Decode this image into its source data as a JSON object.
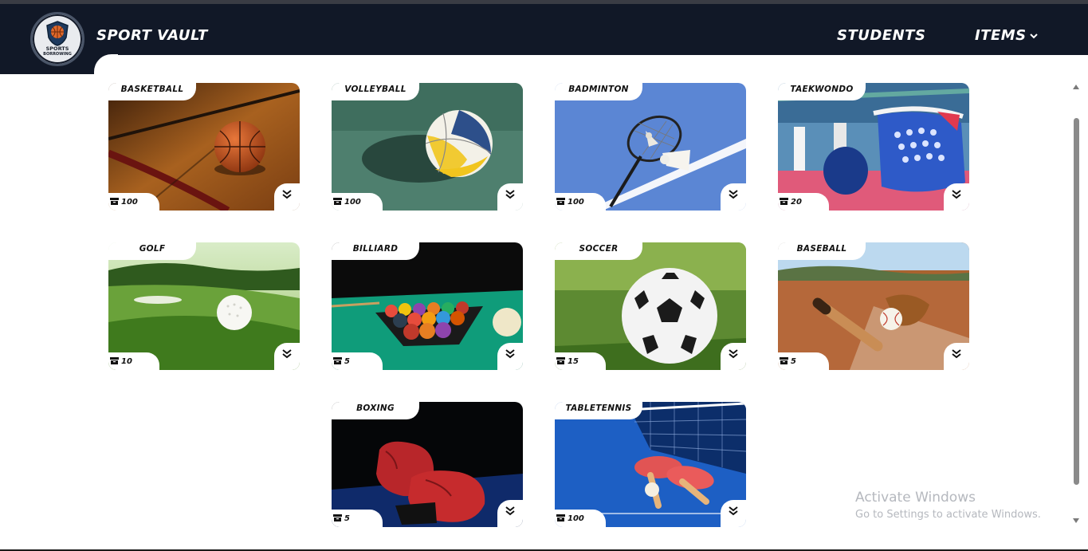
{
  "header": {
    "logo_text_line1": "SPORTS",
    "logo_text_line2": "BORROWING",
    "brand": "SPORT VAULT",
    "nav": {
      "students": "STUDENTS",
      "items": "ITEMS"
    }
  },
  "cards": [
    {
      "label": "BASKETBALL",
      "count": "100"
    },
    {
      "label": "VOLLEYBALL",
      "count": "100"
    },
    {
      "label": "BADMINTON",
      "count": "100"
    },
    {
      "label": "TAEKWONDO",
      "count": "20"
    },
    {
      "label": "GOLF",
      "count": "10"
    },
    {
      "label": "BILLIARD",
      "count": "5"
    },
    {
      "label": "SOCCER",
      "count": "15"
    },
    {
      "label": "BASEBALL",
      "count": "5"
    },
    {
      "label": "BOXING",
      "count": "5"
    },
    {
      "label": "TABLETENNIS",
      "count": "100"
    }
  ],
  "watermark": {
    "title": "Activate Windows",
    "subtitle": "Go to Settings to activate Windows."
  },
  "colors": {
    "navbar": "#111827",
    "background": "#ffffff"
  },
  "icons": {
    "count": "archive-box-icon",
    "expand": "double-chevron-down-icon",
    "dropdown": "chevron-down-icon"
  }
}
